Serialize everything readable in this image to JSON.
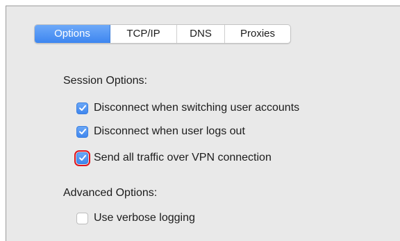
{
  "tabs": [
    {
      "label": "Options",
      "active": true
    },
    {
      "label": "TCP/IP",
      "active": false
    },
    {
      "label": "DNS",
      "active": false
    },
    {
      "label": "Proxies",
      "active": false
    }
  ],
  "session": {
    "heading": "Session Options:",
    "items": [
      {
        "label": "Disconnect when switching user accounts",
        "checked": true
      },
      {
        "label": "Disconnect when user logs out",
        "checked": true
      },
      {
        "label": "Send all traffic over VPN connection",
        "checked": true
      }
    ]
  },
  "advanced": {
    "heading": "Advanced Options:",
    "items": [
      {
        "label": "Use verbose logging",
        "checked": false
      }
    ]
  },
  "colors": {
    "accent": "#4a8ff0",
    "highlight": "#e0141c",
    "panel": "#e9e9e9"
  },
  "icons": {
    "checkmark": "checkmark-icon"
  }
}
